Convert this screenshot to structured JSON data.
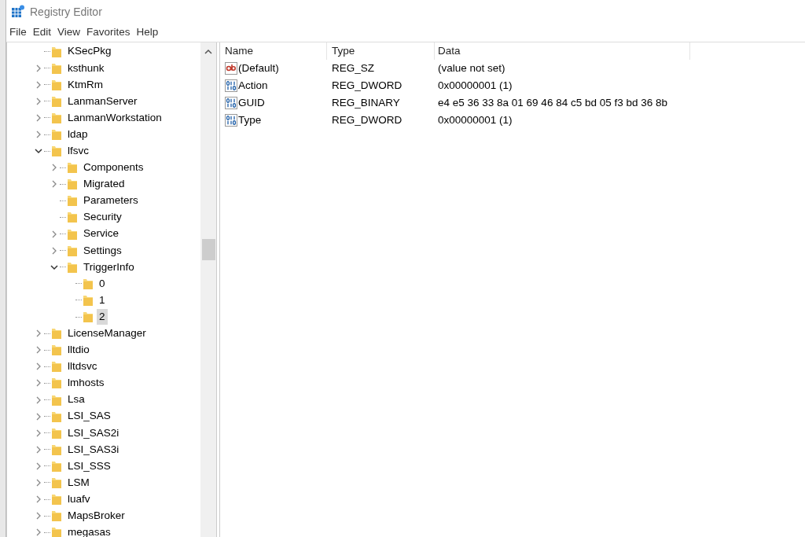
{
  "window": {
    "title": "Registry Editor"
  },
  "menu": [
    "File",
    "Edit",
    "View",
    "Favorites",
    "Help"
  ],
  "tree": [
    {
      "label": "KSecPkg",
      "expandable": false,
      "expanded": false,
      "selected": false
    },
    {
      "label": "ksthunk",
      "expandable": true,
      "expanded": false,
      "selected": false
    },
    {
      "label": "KtmRm",
      "expandable": true,
      "expanded": false,
      "selected": false
    },
    {
      "label": "LanmanServer",
      "expandable": true,
      "expanded": false,
      "selected": false
    },
    {
      "label": "LanmanWorkstation",
      "expandable": true,
      "expanded": false,
      "selected": false
    },
    {
      "label": "ldap",
      "expandable": true,
      "expanded": false,
      "selected": false
    },
    {
      "label": "lfsvc",
      "expandable": true,
      "expanded": true,
      "selected": false,
      "children": [
        {
          "label": "Components",
          "expandable": true,
          "expanded": false,
          "selected": false
        },
        {
          "label": "Migrated",
          "expandable": true,
          "expanded": false,
          "selected": false
        },
        {
          "label": "Parameters",
          "expandable": false,
          "expanded": false,
          "selected": false
        },
        {
          "label": "Security",
          "expandable": false,
          "expanded": false,
          "selected": false
        },
        {
          "label": "Service",
          "expandable": true,
          "expanded": false,
          "selected": false
        },
        {
          "label": "Settings",
          "expandable": true,
          "expanded": false,
          "selected": false
        },
        {
          "label": "TriggerInfo",
          "expandable": true,
          "expanded": true,
          "selected": false,
          "children": [
            {
              "label": "0",
              "expandable": false,
              "expanded": false,
              "selected": false
            },
            {
              "label": "1",
              "expandable": false,
              "expanded": false,
              "selected": false
            },
            {
              "label": "2",
              "expandable": false,
              "expanded": false,
              "selected": true
            }
          ]
        }
      ]
    },
    {
      "label": "LicenseManager",
      "expandable": true,
      "expanded": false,
      "selected": false
    },
    {
      "label": "lltdio",
      "expandable": true,
      "expanded": false,
      "selected": false
    },
    {
      "label": "lltdsvc",
      "expandable": true,
      "expanded": false,
      "selected": false
    },
    {
      "label": "lmhosts",
      "expandable": true,
      "expanded": false,
      "selected": false
    },
    {
      "label": "Lsa",
      "expandable": true,
      "expanded": false,
      "selected": false
    },
    {
      "label": "LSI_SAS",
      "expandable": true,
      "expanded": false,
      "selected": false
    },
    {
      "label": "LSI_SAS2i",
      "expandable": true,
      "expanded": false,
      "selected": false
    },
    {
      "label": "LSI_SAS3i",
      "expandable": true,
      "expanded": false,
      "selected": false
    },
    {
      "label": "LSI_SSS",
      "expandable": true,
      "expanded": false,
      "selected": false
    },
    {
      "label": "LSM",
      "expandable": true,
      "expanded": false,
      "selected": false
    },
    {
      "label": "luafv",
      "expandable": true,
      "expanded": false,
      "selected": false
    },
    {
      "label": "MapsBroker",
      "expandable": true,
      "expanded": false,
      "selected": false
    },
    {
      "label": "megasas",
      "expandable": true,
      "expanded": false,
      "selected": false
    }
  ],
  "values": {
    "columns": [
      "Name",
      "Type",
      "Data"
    ],
    "rows": [
      {
        "kind": "string",
        "name": "(Default)",
        "type": "REG_SZ",
        "data": "(value not set)"
      },
      {
        "kind": "binary",
        "name": "Action",
        "type": "REG_DWORD",
        "data": "0x00000001 (1)"
      },
      {
        "kind": "binary",
        "name": "GUID",
        "type": "REG_BINARY",
        "data": "e4 e5 36 33 8a 01 69 46 84 c5 bd 05 f3 bd 36 8b"
      },
      {
        "kind": "binary",
        "name": "Type",
        "type": "REG_DWORD",
        "data": "0x00000001 (1)"
      }
    ]
  }
}
